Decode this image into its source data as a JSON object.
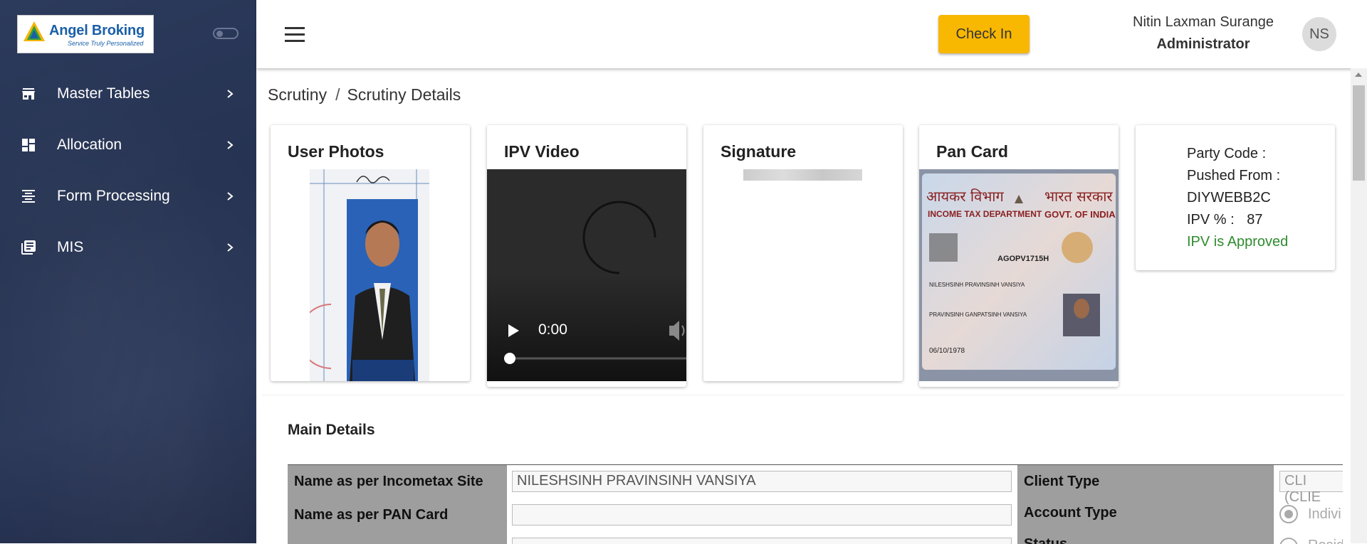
{
  "brand": {
    "name": "Angel Broking",
    "tagline": "Service Truly Personalized",
    "tm": "™"
  },
  "sidebar": {
    "items": [
      {
        "label": "Master Tables",
        "icon": "store-icon"
      },
      {
        "label": "Allocation",
        "icon": "dashboard-icon"
      },
      {
        "label": "Form Processing",
        "icon": "align-center-icon"
      },
      {
        "label": "MIS",
        "icon": "library-books-icon"
      }
    ]
  },
  "header": {
    "checkin_label": "Check In",
    "user_name": "Nitin Laxman Surange",
    "user_role": "Administrator",
    "avatar_initials": "NS"
  },
  "breadcrumb": {
    "root": "Scrutiny",
    "separator": "/",
    "current": "Scrutiny Details"
  },
  "cards": {
    "user_photos": "User Photos",
    "ipv_video": "IPV Video",
    "signature": "Signature",
    "pan_card": "Pan Card"
  },
  "video": {
    "time": "0:00"
  },
  "pan": {
    "hindi_left": "आयकर विभाग",
    "hindi_right": "भारत सरकार",
    "dept": "INCOME TAX DEPARTMENT",
    "govt": "GOVT. OF INDIA",
    "number": "AGOPV1715H",
    "name": "NILESHSINH PRAVINSINH VANSIYA",
    "father": "PRAVINSINH GANPATSINH VANSIYA",
    "dob": "06/10/1978"
  },
  "info": {
    "party_code_label": "Party Code :",
    "pushed_from_label": "Pushed From :",
    "pushed_from_value": "DIYWEBB2C",
    "ipv_percent_label": "IPV % :",
    "ipv_percent_value": "87",
    "ipv_status": "IPV is Approved"
  },
  "main_details": {
    "title": "Main Details",
    "rows_left": [
      {
        "label": "Name as per Incometax Site",
        "value": "NILESHSINH PRAVINSINH VANSIYA"
      },
      {
        "label": "Name as per PAN Card",
        "value": ""
      }
    ],
    "rows_right": [
      {
        "label": "Client Type",
        "value": "CLI (CLIE"
      },
      {
        "label": "Account Type",
        "option": "Indivi"
      },
      {
        "label": "Status",
        "option": "Resid"
      }
    ]
  },
  "colors": {
    "accent": "#f8b700",
    "sidebar": "#2a3758",
    "approved": "#2e8b2e"
  }
}
